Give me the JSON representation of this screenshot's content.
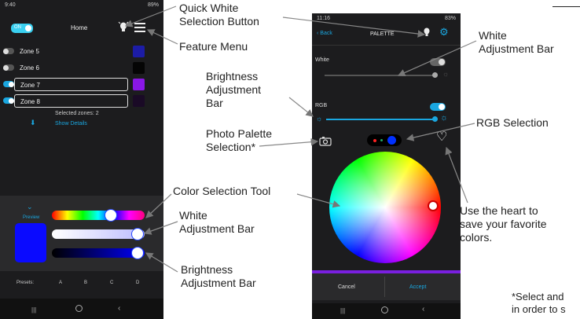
{
  "phone1": {
    "status_time": "9:40",
    "status_right": "89%",
    "power_toggle_label": "ON",
    "title": "Home",
    "zones": [
      {
        "label": "Zone 5",
        "on": false,
        "selected": false,
        "swatch": "#1c1ca6"
      },
      {
        "label": "Zone 6",
        "on": false,
        "selected": false,
        "swatch": "#050505"
      },
      {
        "label": "Zone 7",
        "on": true,
        "selected": true,
        "swatch": "#8a17e6"
      },
      {
        "label": "Zone 8",
        "on": true,
        "selected": true,
        "swatch": "#1a0a26"
      }
    ],
    "selected_zones": "Selected zones: 2",
    "show_details": "Show Details",
    "preview_label": "Preview",
    "preview_color": "#0a0aff",
    "presets_label": "Presets:",
    "presets": [
      "A",
      "B",
      "C",
      "D"
    ]
  },
  "phone2": {
    "status_time": "11:16",
    "status_right": "83%",
    "back_label": "Back",
    "title": "PALETTE",
    "white_label": "White",
    "rgb_label": "RGB",
    "cancel_label": "Cancel",
    "accept_label": "Accept",
    "accent_color": "#1aa7e0",
    "bar_color": "#7a1fe0"
  },
  "annotations": {
    "quick_white": "Quick White\nSelection Button",
    "feature_menu": "Feature Menu",
    "brightness_top": "Brightness\nAdjustment\nBar",
    "photo_palette": "Photo Palette\nSelection*",
    "color_tool": "Color Selection Tool",
    "white_bar_left": "White\nAdjustment Bar",
    "brightness_bottom": "Brightness\nAdjustment Bar",
    "white_bar_right": "White\nAdjustment Bar",
    "rgb_selection": "RGB Selection",
    "heart_note": "Use the heart to\nsave your favorite\ncolors.",
    "footnote": "*Select and\nin order to s"
  }
}
